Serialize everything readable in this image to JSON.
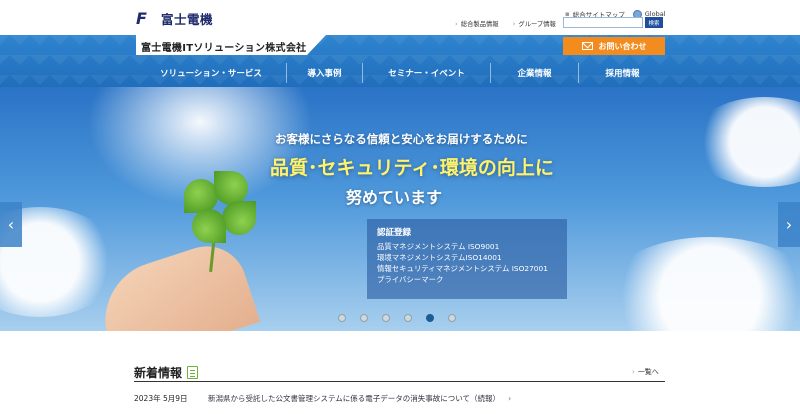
{
  "header": {
    "brand_mark": "F",
    "brand_name": "富士電機",
    "utility_links": [
      "総合サイトマップ",
      "Global"
    ],
    "product_links": [
      "総合製品情報",
      "グループ情報"
    ],
    "search": {
      "button_label": "検索",
      "placeholder": ""
    },
    "company_name": "富士電機ITソリューション株式会社",
    "contact_label": "お問い合わせ"
  },
  "nav": {
    "items": [
      "ソリューション・サービス",
      "導入事例",
      "セミナー・イベント",
      "企業情報",
      "採用情報"
    ]
  },
  "hero": {
    "line1": "お客様にさらなる信頼と安心をお届けするために",
    "line2": "品質･セキュリティ･環境の向上に",
    "line3": "努めています",
    "cert_title": "認証登録",
    "certs": [
      "品質マネジメントシステム ISO9001",
      "環境マネジメントシステムISO14001",
      "情報セキュリティマネジメントシステム ISO27001",
      "プライバシーマーク"
    ],
    "prev_symbol": "‹",
    "next_symbol": "›",
    "slide_count": 6,
    "active_slide": 5
  },
  "news": {
    "title": "新着情報",
    "list_link": "一覧へ",
    "items": [
      {
        "date": "2023年 5月9日",
        "text": "新潟県から受託した公文書管理システムに係る電子データの消失事故について（続報）"
      }
    ]
  }
}
